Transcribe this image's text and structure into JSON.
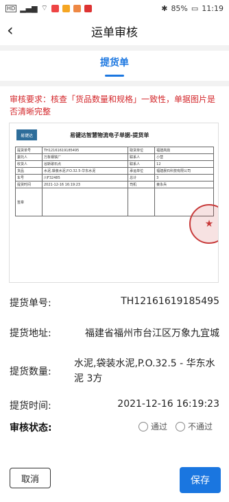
{
  "status_bar": {
    "network": "HD",
    "signal_text": "4G",
    "battery": "85%",
    "time": "11:19"
  },
  "header": {
    "back_icon": "‹",
    "title": "运单审核"
  },
  "tabs": [
    {
      "label": "提货单"
    }
  ],
  "requirement": "审核要求：核查「货品数量和规格」一致性，单据图片是否清晰完整",
  "doc": {
    "logo": "易键达",
    "title": "易键达智慧物流电子单据-提货单",
    "rows": [
      [
        "提货单号",
        "TH12161619185495",
        "取货单位",
        "福建高鼎"
      ],
      [
        "委托人",
        "名称",
        "万象钢铁厂",
        "联系人",
        "小营"
      ],
      [
        "收货人",
        "名称",
        "谷斯歌石点",
        "联系人",
        "12"
      ],
      [
        "货品",
        "水泥,袋装水泥,P.O.32.5-华东水泥",
        "承运单位",
        "福建晨石科技有限公司"
      ],
      [
        "车号",
        "川F32485",
        "总计",
        "3"
      ],
      [
        "提货时间",
        "2021-12-16 16:19:23",
        "司机",
        "姜永兵"
      ],
      [
        "签章",
        "",
        "",
        ""
      ]
    ],
    "stamp_text": "★"
  },
  "fields": {
    "pickup_no_label": "提货单号:",
    "pickup_no": "TH12161619185495",
    "address_label": "提货地址:",
    "address": "福建省福州市台江区万象九宜城",
    "qty_label": "提货数量:",
    "qty": "水泥,袋装水泥,P.O.32.5 - 华东水泥 3方",
    "time_label": "提货时间:",
    "time": "2021-12-16 16:19:23"
  },
  "review": {
    "label": "审核状态:",
    "pass": "通过",
    "fail": "不通过"
  },
  "footer": {
    "cancel": "取消",
    "save": "保存"
  },
  "colors": {
    "accent": "#1a76e0",
    "warning": "#d3262a"
  }
}
